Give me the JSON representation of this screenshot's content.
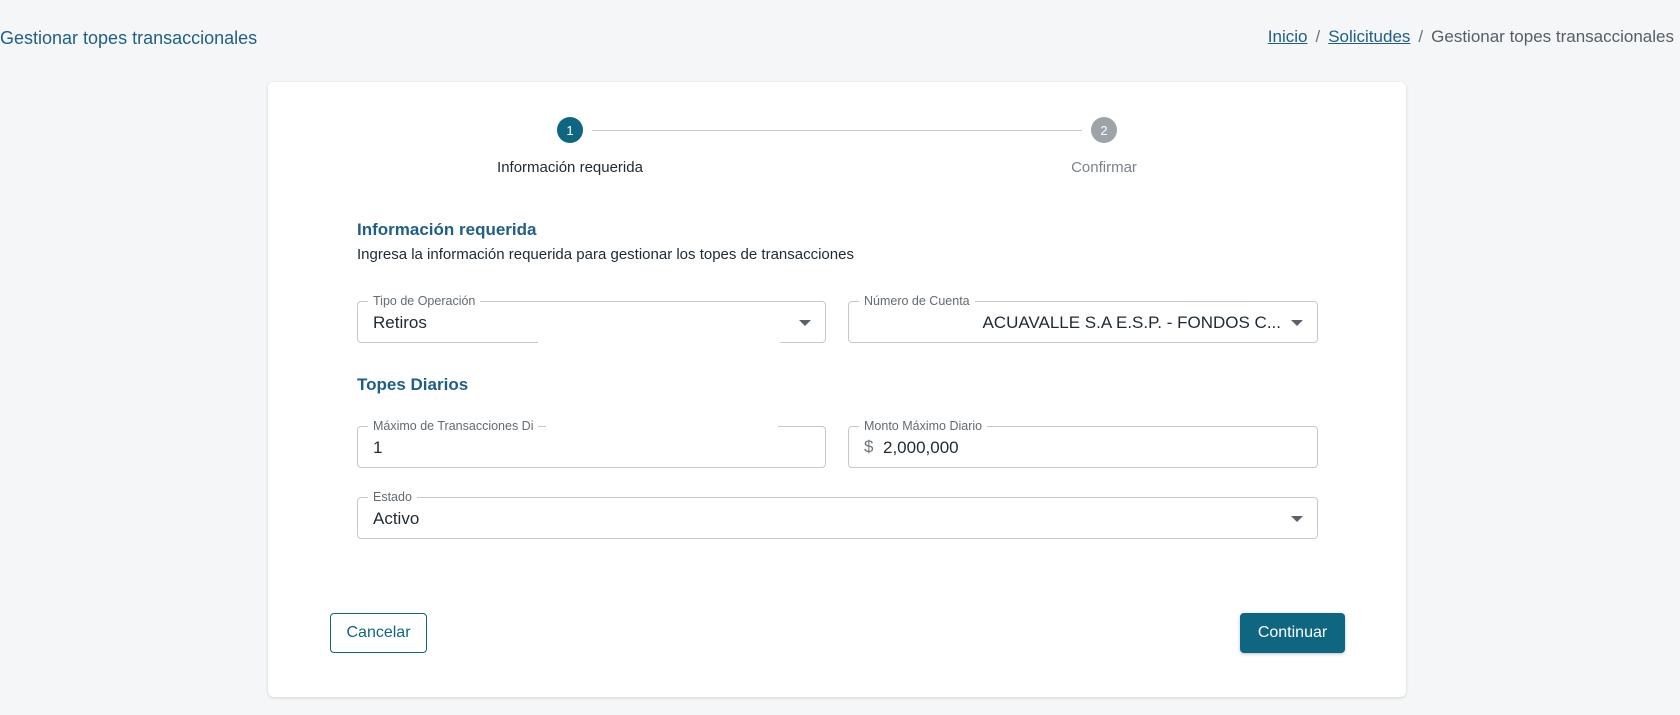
{
  "header": {
    "title": "Gestionar topes transaccionales",
    "breadcrumb": {
      "home": "Inicio",
      "requests": "Solicitudes",
      "current": "Gestionar topes transaccionales",
      "separator": "/"
    }
  },
  "stepper": {
    "steps": [
      {
        "number": "1",
        "label": "Información requerida",
        "state": "active"
      },
      {
        "number": "2",
        "label": "Confirmar",
        "state": "pending"
      }
    ]
  },
  "form": {
    "section_title": "Información requerida",
    "section_description": "Ingresa la información requerida para gestionar los topes de transacciones",
    "operation_type": {
      "label": "Tipo de Operación",
      "value": "Retiros"
    },
    "account_number": {
      "label": "Número de Cuenta",
      "value": "ACUAVALLE S.A E.S.P. - FONDOS C..."
    },
    "daily_limits_title": "Topes Diarios",
    "max_daily_transactions": {
      "label": "Máximo de Transacciones Di",
      "value": "1"
    },
    "max_daily_amount": {
      "label": "Monto Máximo Diario",
      "prefix": "$",
      "value": "2,000,000"
    },
    "status": {
      "label": "Estado",
      "value": "Activo"
    }
  },
  "actions": {
    "cancel_label": "Cancelar",
    "continue_label": "Continuar"
  },
  "colors": {
    "primary": "#0e6680",
    "heading": "#1f5f86",
    "inactive_step": "#9ea3a7",
    "background": "#f4f6f7"
  }
}
